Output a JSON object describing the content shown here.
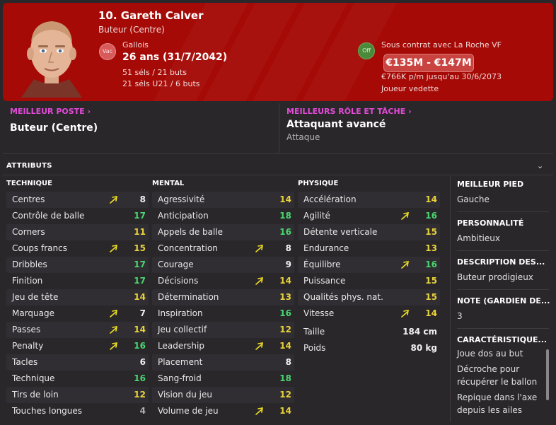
{
  "player": {
    "name": "10. Gareth Calver",
    "position": "Buteur (Centre)",
    "badge_left": "Vac",
    "nationality": "Gallois",
    "age": "26 ans (31/7/2042)",
    "caps_senior": "51 séls / 21 buts",
    "caps_u21": "21 séls U21 / 6 buts",
    "badge_right": "Off",
    "contract": "Sous contrat avec La Roche VF",
    "value": "€135M - €147M",
    "wage": "€766K p/m jusqu'au 30/6/2073",
    "status": "Joueur vedette"
  },
  "roles": {
    "best_position_label": "MEILLEUR POSTE",
    "best_position": "Buteur (Centre)",
    "best_role_label": "MEILLEURS RÔLE ET TÂCHE",
    "best_role": "Attaquant avancé",
    "best_duty": "Attaque"
  },
  "attributes": {
    "title": "ATTRIBUTS",
    "technique_head": "TECHNIQUE",
    "mental_head": "MENTAL",
    "physique_head": "PHYSIQUE",
    "technique": [
      {
        "name": "Centres",
        "value": "8",
        "arrow": true
      },
      {
        "name": "Contrôle de balle",
        "value": "17",
        "arrow": false
      },
      {
        "name": "Corners",
        "value": "11",
        "arrow": false
      },
      {
        "name": "Coups francs",
        "value": "15",
        "arrow": true
      },
      {
        "name": "Dribbles",
        "value": "17",
        "arrow": false
      },
      {
        "name": "Finition",
        "value": "17",
        "arrow": false
      },
      {
        "name": "Jeu de tête",
        "value": "14",
        "arrow": false
      },
      {
        "name": "Marquage",
        "value": "7",
        "arrow": true
      },
      {
        "name": "Passes",
        "value": "14",
        "arrow": true
      },
      {
        "name": "Penalty",
        "value": "16",
        "arrow": true
      },
      {
        "name": "Tacles",
        "value": "6",
        "arrow": false
      },
      {
        "name": "Technique",
        "value": "16",
        "arrow": false
      },
      {
        "name": "Tirs de loin",
        "value": "12",
        "arrow": false
      },
      {
        "name": "Touches longues",
        "value": "4",
        "arrow": false
      }
    ],
    "mental": [
      {
        "name": "Agressivité",
        "value": "14",
        "arrow": false
      },
      {
        "name": "Anticipation",
        "value": "18",
        "arrow": false
      },
      {
        "name": "Appels de balle",
        "value": "16",
        "arrow": false
      },
      {
        "name": "Concentration",
        "value": "8",
        "arrow": true
      },
      {
        "name": "Courage",
        "value": "9",
        "arrow": false
      },
      {
        "name": "Décisions",
        "value": "14",
        "arrow": true
      },
      {
        "name": "Détermination",
        "value": "13",
        "arrow": false
      },
      {
        "name": "Inspiration",
        "value": "16",
        "arrow": false
      },
      {
        "name": "Jeu collectif",
        "value": "12",
        "arrow": false
      },
      {
        "name": "Leadership",
        "value": "14",
        "arrow": true
      },
      {
        "name": "Placement",
        "value": "8",
        "arrow": false
      },
      {
        "name": "Sang-froid",
        "value": "18",
        "arrow": false
      },
      {
        "name": "Vision du jeu",
        "value": "12",
        "arrow": false
      },
      {
        "name": "Volume de jeu",
        "value": "14",
        "arrow": true
      }
    ],
    "physique": [
      {
        "name": "Accélération",
        "value": "14",
        "arrow": false
      },
      {
        "name": "Agilité",
        "value": "16",
        "arrow": true
      },
      {
        "name": "Détente verticale",
        "value": "15",
        "arrow": false
      },
      {
        "name": "Endurance",
        "value": "13",
        "arrow": false
      },
      {
        "name": "Équilibre",
        "value": "16",
        "arrow": true
      },
      {
        "name": "Puissance",
        "value": "15",
        "arrow": false
      },
      {
        "name": "Qualités phys. nat.",
        "value": "15",
        "arrow": false
      },
      {
        "name": "Vitesse",
        "value": "14",
        "arrow": true
      }
    ],
    "height_label": "Taille",
    "height": "184 cm",
    "weight_label": "Poids",
    "weight": "80 kg"
  },
  "side": {
    "foot_title": "MEILLEUR PIED",
    "foot": "Gauche",
    "personality_title": "PERSONNALITÉ",
    "personality": "Ambitieux",
    "description_title": "DESCRIPTION DES...",
    "description": "Buteur prodigieux",
    "gk_rating_title": "NOTE (GARDIEN DE...",
    "gk_rating": "3",
    "traits_title": "CARACTÉRISTIQUE...",
    "traits": [
      "Joue dos au but",
      "Décroche pour récupérer le ballon",
      "Repique dans l'axe depuis les ailes"
    ]
  },
  "colors": {
    "header_bg": "#a50a06",
    "link": "#e24ad7",
    "value_good": "#48d66e",
    "value_ok": "#e8d23a",
    "arrow": "#f0e020"
  }
}
